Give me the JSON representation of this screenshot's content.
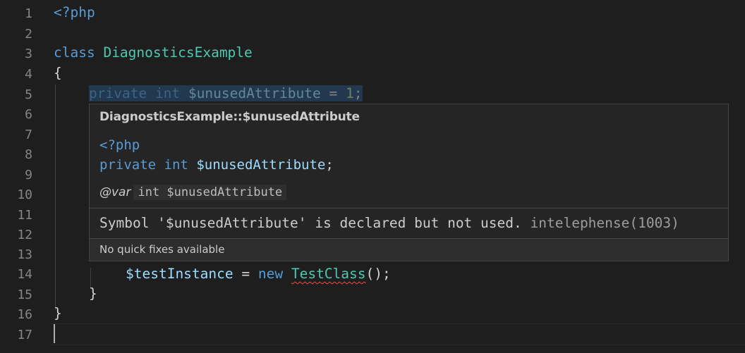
{
  "editor": {
    "line_numbers": [
      "1",
      "2",
      "3",
      "4",
      "5",
      "6",
      "7",
      "8",
      "9",
      "10",
      "11",
      "12",
      "13",
      "14",
      "15",
      "16",
      "17"
    ],
    "lines": {
      "l1": {
        "open": "<?php"
      },
      "l3": {
        "kw": "class",
        "name": "DiagnosticsExample"
      },
      "l4": {
        "brace": "{"
      },
      "l5": {
        "kw1": "private",
        "kw2": "int",
        "var": "$unusedAttribute",
        "eq": " = ",
        "num": "1",
        "semi": ";"
      },
      "l14": {
        "var": "$testInstance",
        "eq": " = ",
        "kw": "new",
        "cls": "TestClass",
        "tail": "();"
      },
      "l15": {
        "brace": "}"
      },
      "l16": {
        "brace": "}"
      }
    }
  },
  "hover": {
    "title": "DiagnosticsExample::$unusedAttribute",
    "code_open": "<?php",
    "code_kw1": "private",
    "code_kw2": "int",
    "code_var": "$unusedAttribute",
    "code_semi": ";",
    "var_tag": "@var",
    "var_code": "int $unusedAttribute",
    "message": "Symbol '$unusedAttribute' is declared but not used.",
    "source": "intelephense(1003)",
    "status": "No quick fixes available"
  },
  "colors": {
    "background": "#1e1e1e",
    "keyword": "#569cd6",
    "class": "#4ec9b0",
    "variable": "#9cdcfe",
    "hover_bg": "#252526",
    "error_squiggle": "#f14c4c"
  }
}
